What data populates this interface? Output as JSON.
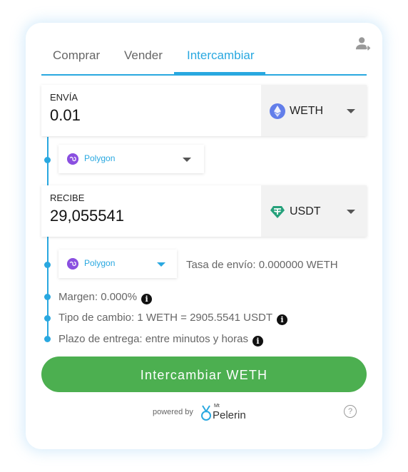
{
  "tabs": [
    {
      "label": "Comprar"
    },
    {
      "label": "Vender"
    },
    {
      "label": "Intercambiar"
    }
  ],
  "send": {
    "label": "ENVÍA",
    "amount": "0.01",
    "token": "WETH"
  },
  "send_network": {
    "name": "Polygon"
  },
  "receive": {
    "label": "RECIBE",
    "amount": "29,055541",
    "token": "USDT"
  },
  "receive_network": {
    "name": "Polygon"
  },
  "shipping_fee": "Tasa de envío: 0.000000 WETH",
  "margin": "Margen: 0.000%",
  "exchange_rate": "Tipo de cambio: 1 WETH = 2905.5541 USDT",
  "delivery": "Plazo de entrega: entre minutos y horas",
  "info_glyph": "i",
  "cta_label": "Intercambiar WETH",
  "footer": {
    "powered_by": "powered by",
    "brand_small": "Mt",
    "brand": "Pelerin",
    "help_glyph": "?"
  },
  "colors": {
    "accent": "#29a8e0",
    "cta": "#4caf50",
    "polygon": "#8a4fe0",
    "weth": "#627eea",
    "usdt": "#26a17b"
  },
  "icons": [
    "user-switch-icon",
    "ethereum-icon",
    "tether-icon",
    "polygon-icon",
    "info-icon",
    "help-icon",
    "mt-pelerin-logo"
  ]
}
